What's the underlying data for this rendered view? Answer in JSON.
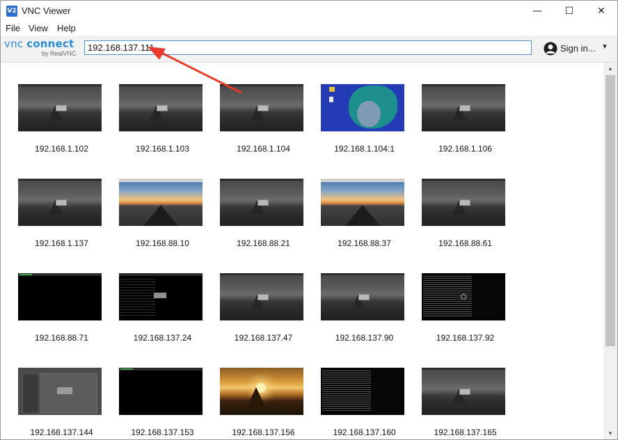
{
  "window": {
    "title": "VNC Viewer",
    "app_icon_text": "V2",
    "controls": {
      "minimize": "—",
      "maximize": "☐",
      "close": "✕"
    }
  },
  "menu": {
    "file": "File",
    "view": "View",
    "help": "Help"
  },
  "toolbar": {
    "logo_vnc": "vnc",
    "logo_connect": "connect",
    "logo_byline": "by RealVNC",
    "address_value": "192.168.137.111",
    "sign_in_label": "Sign in...",
    "sign_in_caret": "▼"
  },
  "annotation": {
    "arrow_color": "#e8392b"
  },
  "scrollbar": {
    "up_glyph": "▲",
    "down_glyph": "▼"
  },
  "connections": [
    {
      "label": "192.168.1.102",
      "thumb": "gray"
    },
    {
      "label": "192.168.1.103",
      "thumb": "gray"
    },
    {
      "label": "192.168.1.104",
      "thumb": "gray"
    },
    {
      "label": "192.168.1.104:1",
      "thumb": "blue"
    },
    {
      "label": "192.168.1.106",
      "thumb": "gray"
    },
    {
      "label": "192.168.1.137",
      "thumb": "gray"
    },
    {
      "label": "192.168.88.10",
      "thumb": "road"
    },
    {
      "label": "192.168.88.21",
      "thumb": "gray"
    },
    {
      "label": "192.168.88.37",
      "thumb": "road"
    },
    {
      "label": "192.168.88.61",
      "thumb": "gray"
    },
    {
      "label": "192.168.88.71",
      "thumb": "black-green"
    },
    {
      "label": "192.168.137.24",
      "thumb": "black-dialog"
    },
    {
      "label": "192.168.137.47",
      "thumb": "gray"
    },
    {
      "label": "192.168.137.90",
      "thumb": "gray"
    },
    {
      "label": "192.168.137.92",
      "thumb": "terminal-spin"
    },
    {
      "label": "192.168.137.144",
      "thumb": "desktop"
    },
    {
      "label": "192.168.137.153",
      "thumb": "black-green"
    },
    {
      "label": "192.168.137.156",
      "thumb": "sunset"
    },
    {
      "label": "192.168.137.160",
      "thumb": "terminal"
    },
    {
      "label": "192.168.137.165",
      "thumb": "gray"
    }
  ]
}
